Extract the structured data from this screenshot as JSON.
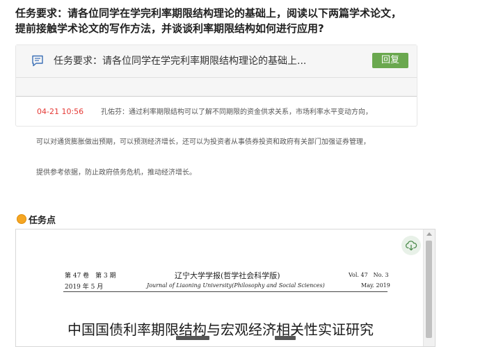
{
  "task": {
    "title_line1": "任务要求：请各位同学在学完利率期限结构理论的基础上，阅读以下两篇学术论文，",
    "title_line2": "提前接触学术论文的写作方法，并谈谈利率期限结构如何进行应用?"
  },
  "discussion": {
    "card_title": "任务要求：请各位同学在学完利率期限结构理论的基础上...",
    "reply_label": "回复",
    "reply": {
      "time": "04-21 10:56",
      "line1": "孔佑芬：通过利率期限结构可以了解不同期限的资金供求关系，市场利率水平变动方向，",
      "line2": "可以对通货膨胀做出预期，可以预测经济增长，还可以为投资者从事债券投资和政府有关部门加强证券管理，",
      "line3": "提供参考依据，防止政府债务危机，推动经济增长。"
    }
  },
  "task_point": {
    "label": "任务点"
  },
  "document": {
    "volume_cn": "第 47 卷　第 3 期",
    "date_cn": "2019 年 5 月",
    "journal_cn": "辽宁大学学报(哲学社会科学版)",
    "journal_en": "Journal of Liaoning University(Philosophy and Social Sciences)",
    "volume_en": "Vol. 47　No. 3",
    "date_en": "May. 2019",
    "title": "中国国债利率期限结构与宏观经济相关性实证研究"
  },
  "colors": {
    "reply_button": "#6aa84f",
    "reply_time": "#e53935",
    "task_dot": "#f5a623"
  }
}
